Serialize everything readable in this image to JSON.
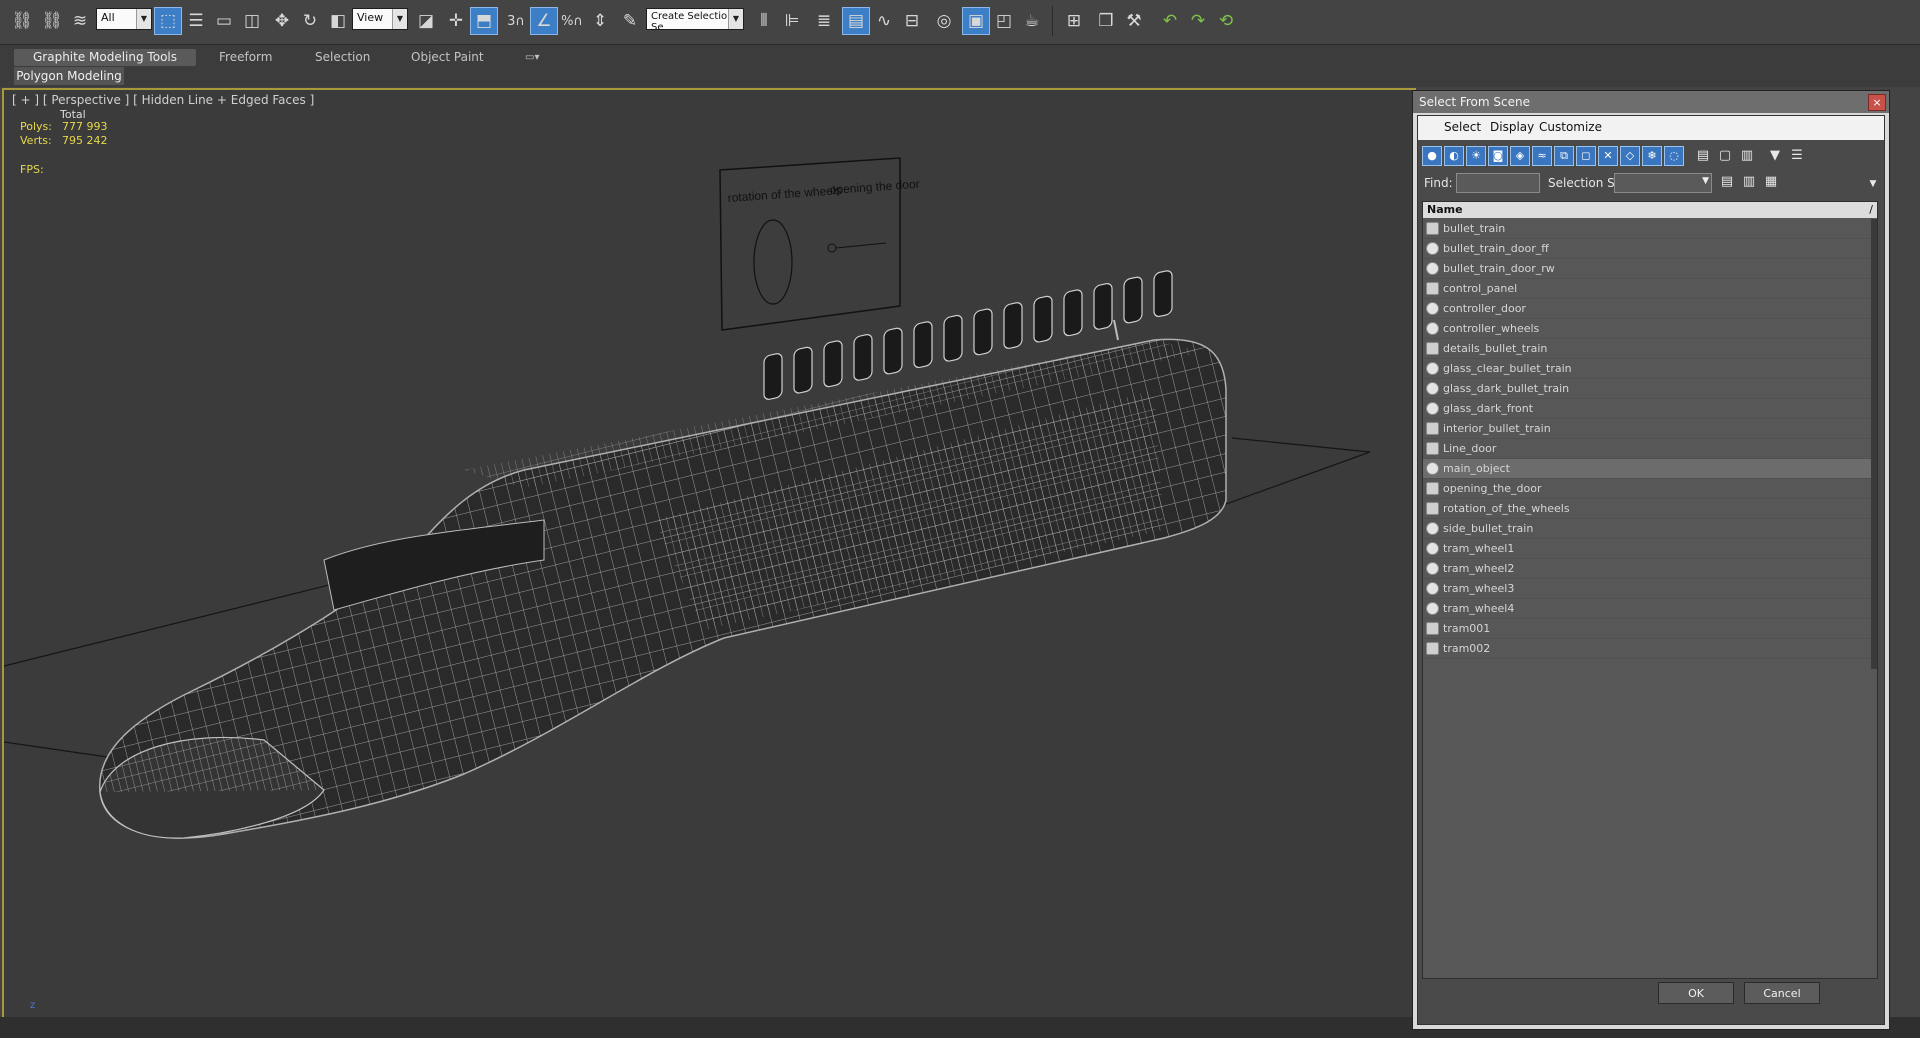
{
  "toolbar": {
    "filter_value": "All",
    "refcoord_value": "View",
    "snap_count": "3",
    "percent_label": "%",
    "named_selection_placeholder": "Create Selection Se"
  },
  "ribbon": {
    "tabs": [
      "Graphite Modeling Tools",
      "Freeform",
      "Selection",
      "Object Paint"
    ],
    "subtab": "Polygon Modeling"
  },
  "viewport": {
    "label": "[ + ] [ Perspective ] [ Hidden Line + Edged Faces ]",
    "stats": {
      "total_label": "Total",
      "polys_label": "Polys:",
      "polys_value": "777 993",
      "verts_label": "Verts:",
      "verts_value": "795 242",
      "fps_label": "FPS:"
    },
    "board": {
      "left_text": "rotation of the wheels",
      "right_text": "opening the door"
    },
    "axis_label": "z"
  },
  "dialog": {
    "title": "Select From Scene",
    "close_glyph": "×",
    "menu": [
      "Select",
      "Display",
      "Customize"
    ],
    "find_label": "Find:",
    "selection_set_label": "Selection Set:",
    "column_header": "Name",
    "sort_glyph": "/",
    "selected_index": 12,
    "items": [
      {
        "name": "bullet_train",
        "icon": "group-icon"
      },
      {
        "name": "bullet_train_door_ff",
        "icon": "object-icon"
      },
      {
        "name": "bullet_train_door_rw",
        "icon": "object-icon"
      },
      {
        "name": "control_panel",
        "icon": "group-icon"
      },
      {
        "name": "controller_door",
        "icon": "object-icon"
      },
      {
        "name": "controller_wheels",
        "icon": "object-icon"
      },
      {
        "name": "details_bullet_train",
        "icon": "group-icon"
      },
      {
        "name": "glass_clear_bullet_train",
        "icon": "object-icon"
      },
      {
        "name": "glass_dark_bullet_train",
        "icon": "object-icon"
      },
      {
        "name": "glass_dark_front",
        "icon": "object-icon"
      },
      {
        "name": "interior_bullet_train",
        "icon": "group-icon"
      },
      {
        "name": "Line_door",
        "icon": "group-icon"
      },
      {
        "name": "main_object",
        "icon": "object-icon"
      },
      {
        "name": "opening_the_door",
        "icon": "group-icon"
      },
      {
        "name": "rotation_of_the_wheels",
        "icon": "group-icon"
      },
      {
        "name": "side_bullet_train",
        "icon": "object-icon"
      },
      {
        "name": "tram_wheel1",
        "icon": "object-icon"
      },
      {
        "name": "tram_wheel2",
        "icon": "object-icon"
      },
      {
        "name": "tram_wheel3",
        "icon": "object-icon"
      },
      {
        "name": "tram_wheel4",
        "icon": "object-icon"
      },
      {
        "name": "tram001",
        "icon": "group-icon"
      },
      {
        "name": "tram002",
        "icon": "group-icon"
      }
    ],
    "ok_label": "OK",
    "cancel_label": "Cancel"
  },
  "colors": {
    "viewport_border": "#a89a3c",
    "stats_text": "#e6d84a",
    "active_button": "#3d7fc6",
    "viewport_bg": "#3b3b3b"
  }
}
